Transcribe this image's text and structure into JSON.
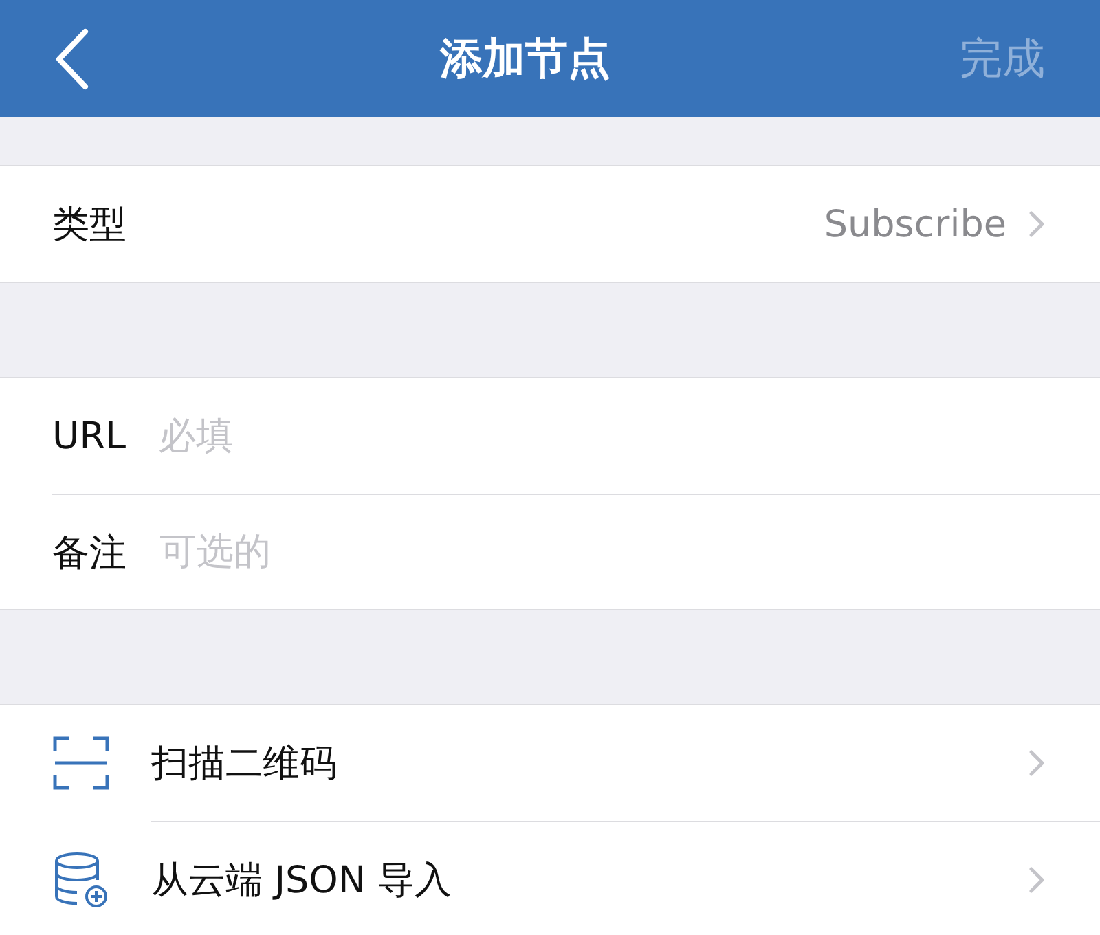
{
  "header": {
    "title": "添加节点",
    "done": {
      "label": "完成",
      "disabled": true
    }
  },
  "type_row": {
    "label": "类型",
    "value": "Subscribe"
  },
  "fields": [
    {
      "label": "URL",
      "placeholder": "必填"
    },
    {
      "label": "备注",
      "placeholder": "可选的"
    }
  ],
  "actions": [
    {
      "kind": "scan",
      "label": "扫描二维码"
    },
    {
      "kind": "import",
      "label": "从云端 JSON 导入"
    }
  ]
}
